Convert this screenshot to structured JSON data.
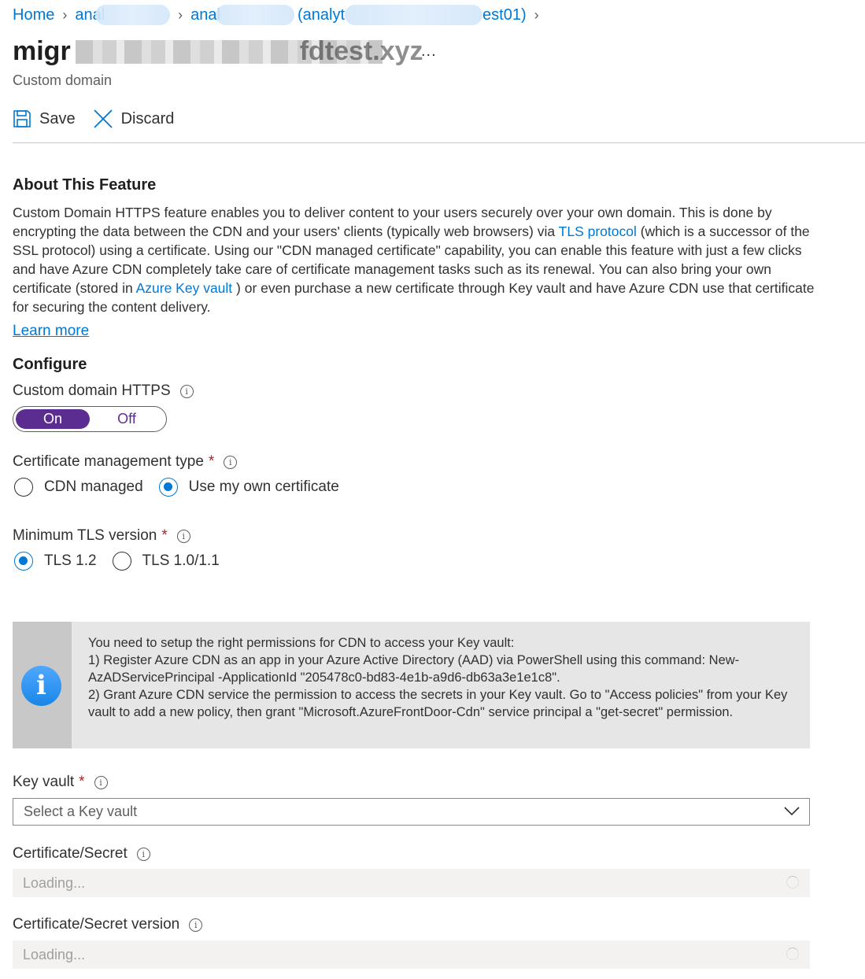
{
  "breadcrumb": {
    "home": "Home",
    "item1": "anal",
    "item2": "anal",
    "item3_a": "(analyt",
    "item3_b": "est01)"
  },
  "header": {
    "title_visible_start": "migr",
    "title_visible_end": "fdtest.xyz",
    "more": "...",
    "subtitle": "Custom domain"
  },
  "toolbar": {
    "save_label": "Save",
    "discard_label": "Discard"
  },
  "about": {
    "heading": "About This Feature",
    "p1": "Custom Domain HTTPS feature enables you to deliver content to your users securely over your own domain. This is done by encrypting the data between the CDN and your users' clients (typically web browsers) via ",
    "tls_link": "TLS protocol",
    "p2": " (which is a successor of the SSL protocol) using a certificate. Using our \"CDN managed certificate\" capability, you can enable this feature with just a few clicks and have Azure CDN completely take care of certificate management tasks such as its renewal. You can also bring your own certificate (stored in ",
    "kv_link": "Azure Key vault",
    "p3": " ) or even purchase a new certificate through Key vault and have Azure CDN use that certificate for securing the content delivery.",
    "learn_more": "Learn more"
  },
  "configure": {
    "heading": "Configure",
    "https_label": "Custom domain HTTPS",
    "toggle_on": "On",
    "toggle_off": "Off",
    "toggle_state": "On",
    "cert_type_label": "Certificate management type",
    "cert_options": [
      "CDN managed",
      "Use my own certificate"
    ],
    "cert_selected": "Use my own certificate",
    "tls_label": "Minimum TLS version",
    "tls_options": [
      "TLS 1.2",
      "TLS 1.0/1.1"
    ],
    "tls_selected": "TLS 1.2",
    "required_mark": "*",
    "info_glyph": "i"
  },
  "infobox": {
    "icon": "info-icon",
    "line1": "You need to setup the right permissions for CDN to access your Key vault:",
    "line2": "1) Register Azure CDN as an app in your Azure Active Directory (AAD) via PowerShell using this command: New-AzADServicePrincipal -ApplicationId \"205478c0-bd83-4e1b-a9d6-db63a3e1e1c8\".",
    "line3": "2) Grant Azure CDN service the permission to access the secrets in your Key vault. Go to \"Access policies\" from your Key vault to add a new policy, then grant \"Microsoft.AzureFrontDoor-Cdn\" service principal a \"get-secret\" permission."
  },
  "key_vault": {
    "label": "Key vault",
    "placeholder": "Select a Key vault"
  },
  "certificate": {
    "label": "Certificate/Secret",
    "value": "Loading..."
  },
  "certificate_version": {
    "label": "Certificate/Secret version",
    "value": "Loading..."
  },
  "colors": {
    "accent": "#0078d4",
    "toggle": "#5c2d91",
    "required": "#a4262c"
  }
}
